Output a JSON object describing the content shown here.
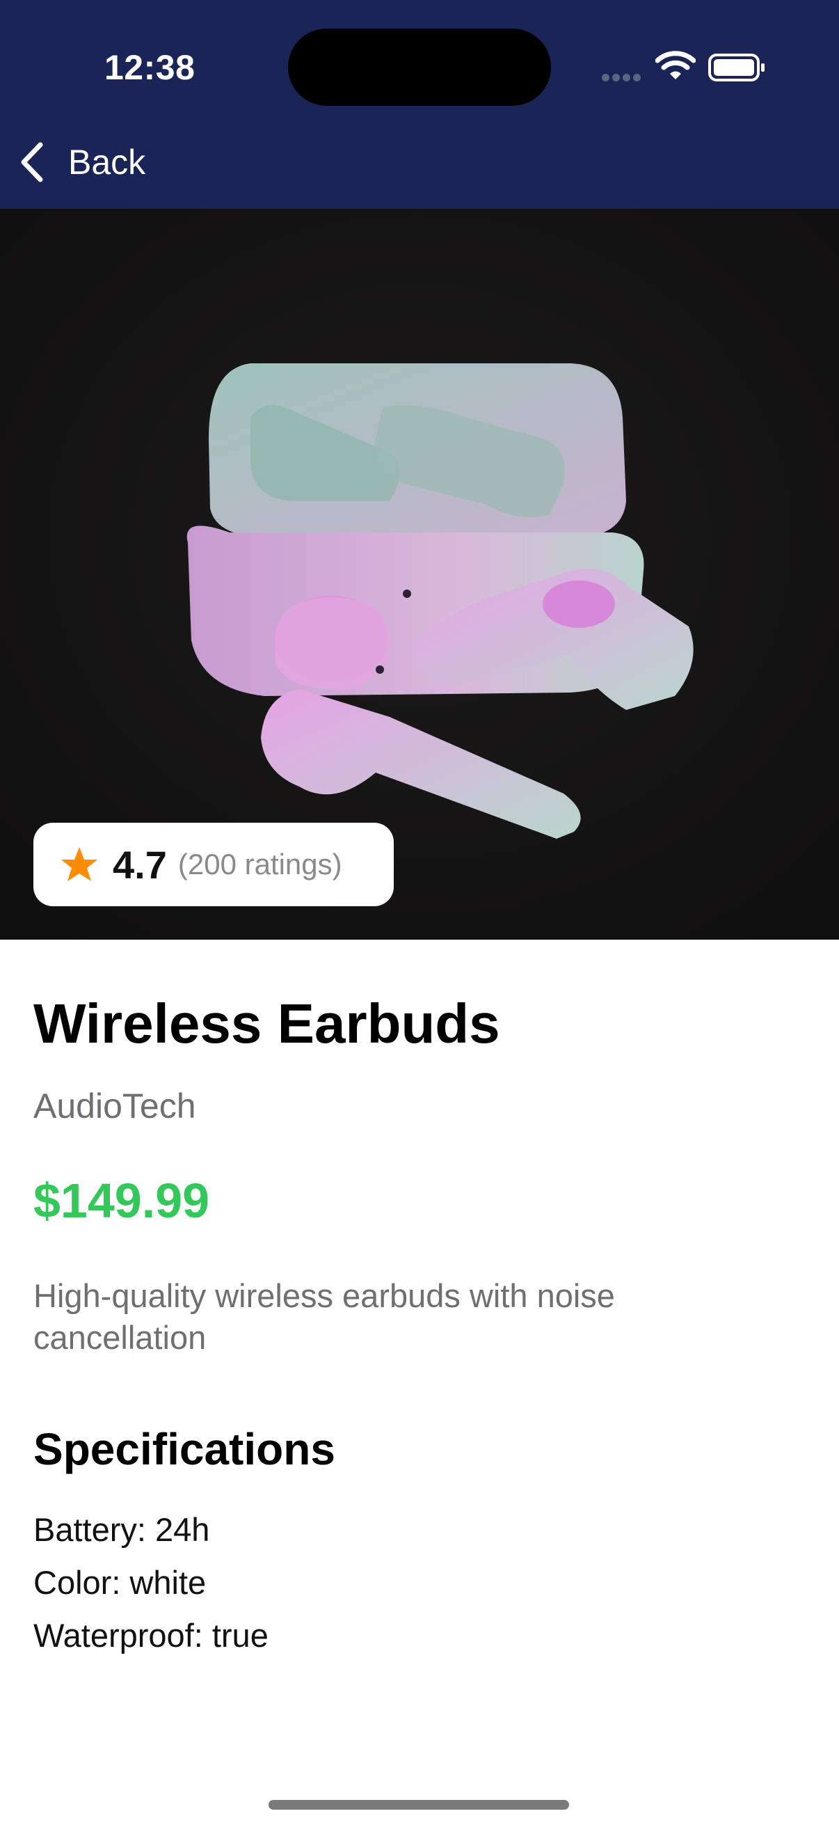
{
  "status_bar": {
    "time": "12:38"
  },
  "nav": {
    "back_label": "Back"
  },
  "product": {
    "rating": "4.7",
    "rating_count": "(200 ratings)",
    "title": "Wireless Earbuds",
    "brand": "AudioTech",
    "price": "$149.99",
    "description": "High-quality wireless earbuds with noise cancellation"
  },
  "specifications": {
    "heading": "Specifications",
    "items": [
      "Battery: 24h",
      "Color: white",
      "Waterproof: true"
    ]
  },
  "colors": {
    "header_bg": "#1a2456",
    "price": "#34c759",
    "star": "#ff8c00",
    "secondary_text": "#6e6e73"
  },
  "icons": {
    "back": "chevron-left-icon",
    "star": "star-icon",
    "wifi": "wifi-icon",
    "battery": "battery-icon"
  }
}
